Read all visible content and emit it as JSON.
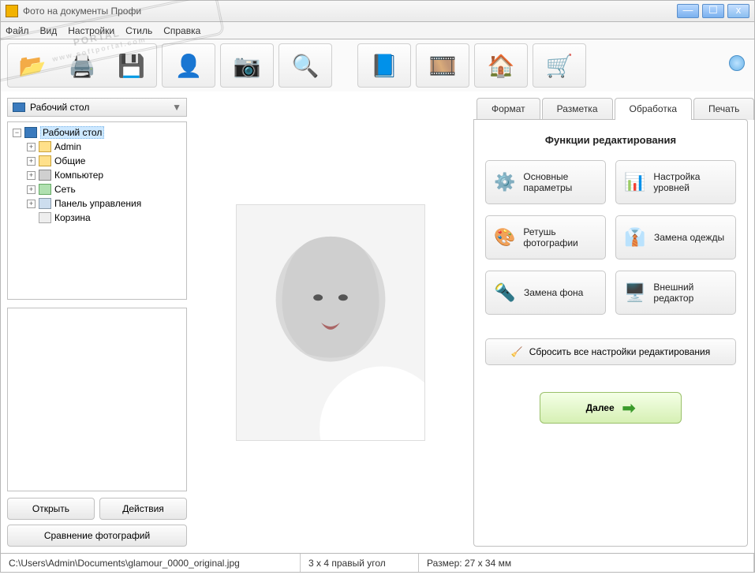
{
  "window": {
    "title": "Фото на документы Профи"
  },
  "menu": {
    "file": "Файл",
    "view": "Вид",
    "settings": "Настройки",
    "style": "Стиль",
    "help": "Справка"
  },
  "sidebar": {
    "location": "Рабочий стол",
    "root": "Рабочий стол",
    "items": [
      {
        "label": "Admin",
        "icon": "folder",
        "exp": true
      },
      {
        "label": "Общие",
        "icon": "folder",
        "exp": true
      },
      {
        "label": "Компьютер",
        "icon": "computer",
        "exp": true
      },
      {
        "label": "Сеть",
        "icon": "network",
        "exp": true
      },
      {
        "label": "Панель управления",
        "icon": "panel",
        "exp": true
      },
      {
        "label": "Корзина",
        "icon": "trash",
        "exp": false
      }
    ],
    "open_btn": "Открыть",
    "actions_btn": "Действия",
    "compare_btn": "Сравнение фотографий"
  },
  "tabs": {
    "format": "Формат",
    "layout": "Разметка",
    "processing": "Обработка",
    "print": "Печать"
  },
  "processing": {
    "heading": "Функции редактирования",
    "funcs": {
      "basic": "Основные параметры",
      "levels": "Настройка уровней",
      "retouch": "Ретушь фотографии",
      "clothes": "Замена одежды",
      "background": "Замена фона",
      "external": "Внешний редактор"
    },
    "reset": "Сбросить все настройки редактирования",
    "next": "Далее"
  },
  "status": {
    "path": "C:\\Users\\Admin\\Documents\\glamour_0000_original.jpg",
    "corner": "3 x 4 правый угол",
    "size": "Размер: 27 x 34 мм"
  },
  "watermark": {
    "main": "PORTAL",
    "sub": "www.softportal.com"
  }
}
